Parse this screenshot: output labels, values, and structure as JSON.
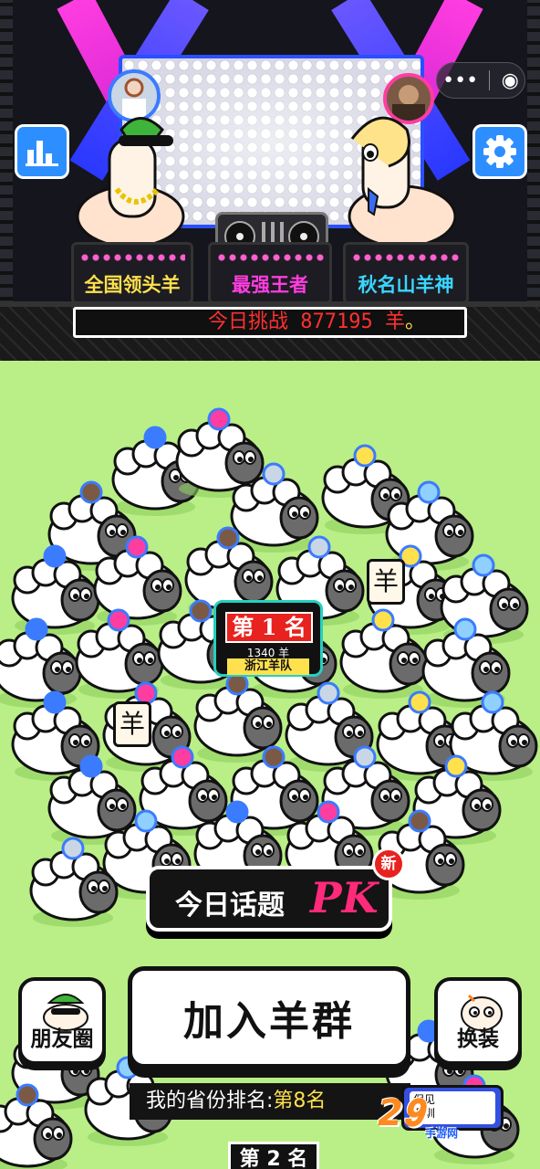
{
  "stage": {
    "podiums": [
      {
        "label": "全国领头羊",
        "color": "#ffe14d"
      },
      {
        "label": "最强王者",
        "color": "#ff3de0"
      },
      {
        "label": "秋名山羊神",
        "color": "#3ad6ff"
      }
    ],
    "ticker": {
      "text": "今日挑战 877195 羊",
      "suffix": "。"
    }
  },
  "topbar": {
    "more_icon": "more-dots-icon",
    "close_icon": "record-circle-icon",
    "more_glyph": "•••",
    "close_glyph": "◉"
  },
  "buttons": {
    "leaderboard_icon": "bar-chart-icon",
    "settings_icon": "gear-icon"
  },
  "field": {
    "tile_char": "羊",
    "rank_badge": {
      "rank": "第 1 名",
      "count": "1340 羊",
      "team": "浙江羊队"
    }
  },
  "topic_pk": {
    "title": "今日话题",
    "pk": "PK",
    "new_badge": "新"
  },
  "actions": {
    "join_label": "加入羊群",
    "moments_label": "朋友圈",
    "dressup_label": "换装"
  },
  "province": {
    "label": "我的省份排名:",
    "rank": "第8名"
  },
  "side_card": {
    "line1": "保见",
    "line2": "深圳"
  },
  "bottom_tab": {
    "label": "第 2 名"
  },
  "watermark": {
    "brand": "2𝟗",
    "sub": "手游网"
  },
  "colors": {
    "field": "#b9ef86",
    "accent_red": "#e8221e",
    "accent_blue": "#2d8fff",
    "pk_pink": "#ff2a7a"
  }
}
